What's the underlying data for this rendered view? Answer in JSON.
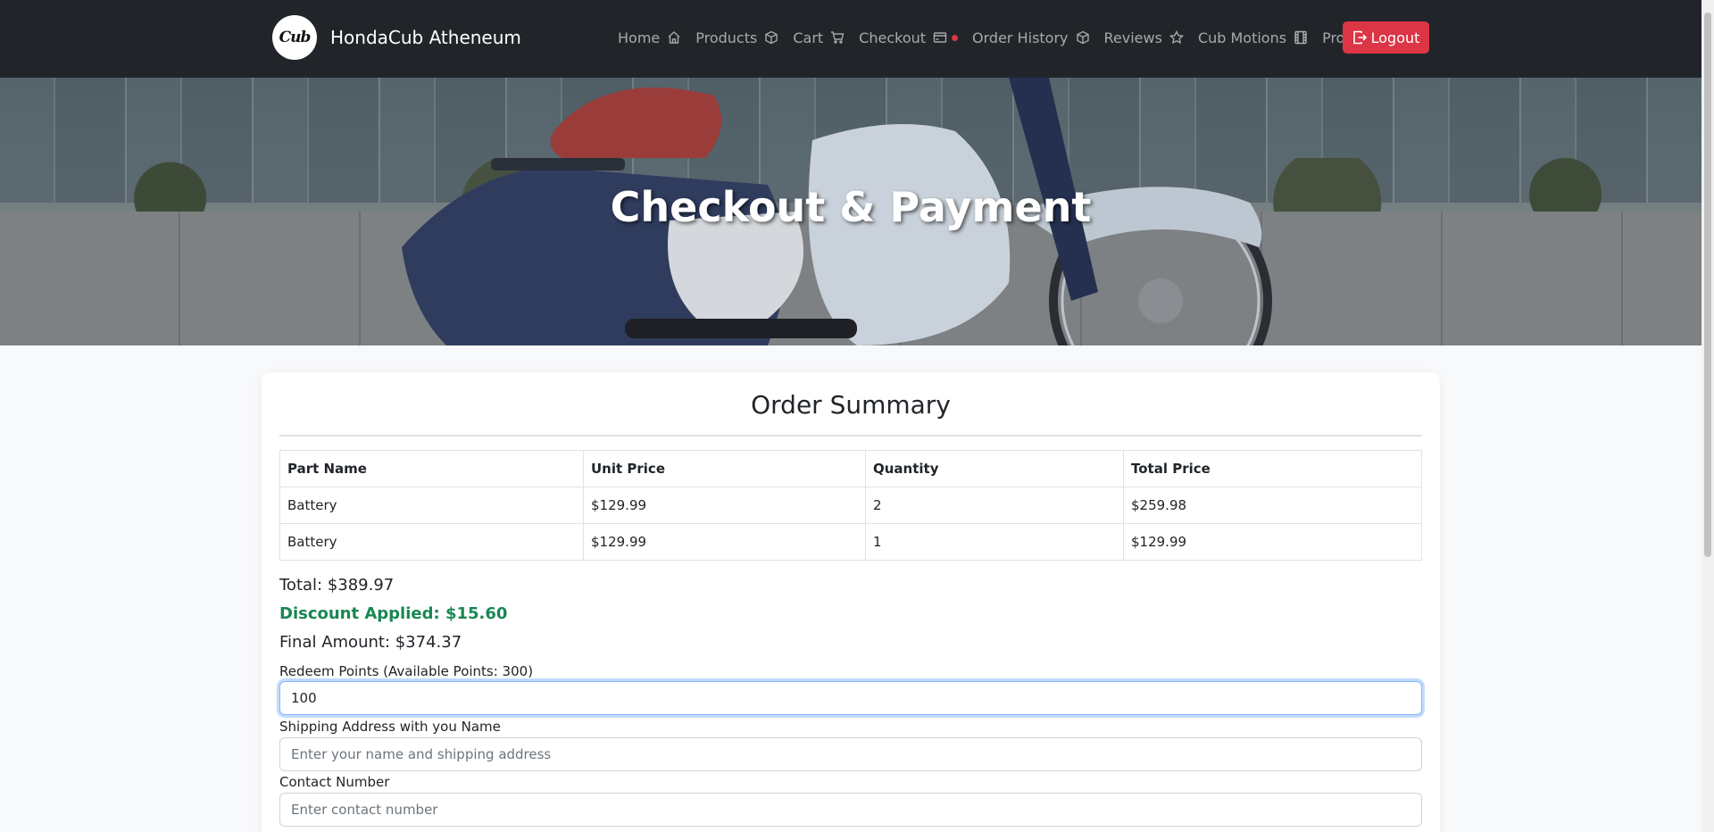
{
  "brand": {
    "logo_text": "Cub",
    "name": "HondaCub Atheneum"
  },
  "nav": {
    "items": [
      {
        "label": "Home",
        "icon": "home-icon"
      },
      {
        "label": "Products",
        "icon": "box-icon"
      },
      {
        "label": "Cart",
        "icon": "cart-icon"
      },
      {
        "label": "Checkout",
        "icon": "credit-card-icon"
      },
      {
        "label": "Order History",
        "icon": "box-icon"
      },
      {
        "label": "Reviews",
        "icon": "star-icon"
      },
      {
        "label": "Cub Motions",
        "icon": "film-icon"
      },
      {
        "label": "Profile",
        "icon": "person-icon"
      }
    ],
    "logout_label": "Logout"
  },
  "hero": {
    "title": "Checkout & Payment"
  },
  "order": {
    "title": "Order Summary",
    "columns": [
      "Part Name",
      "Unit Price",
      "Quantity",
      "Total Price"
    ],
    "rows": [
      [
        "Battery",
        "$129.99",
        "2",
        "$259.98"
      ],
      [
        "Battery",
        "$129.99",
        "1",
        "$129.99"
      ]
    ],
    "total": "Total: $389.97",
    "discount": "Discount Applied: $15.60",
    "final": "Final Amount: $374.37"
  },
  "form": {
    "redeem_label": "Redeem Points (Available Points: 300)",
    "redeem_value": "100",
    "shipping_label": "Shipping Address with you Name",
    "shipping_placeholder": "Enter your name and shipping address",
    "contact_label": "Contact Number",
    "contact_placeholder": "Enter contact number"
  },
  "colors": {
    "navbar": "#212529",
    "logout": "#dc3545",
    "discount": "#198754",
    "checkout_dot": "#dc3545"
  }
}
